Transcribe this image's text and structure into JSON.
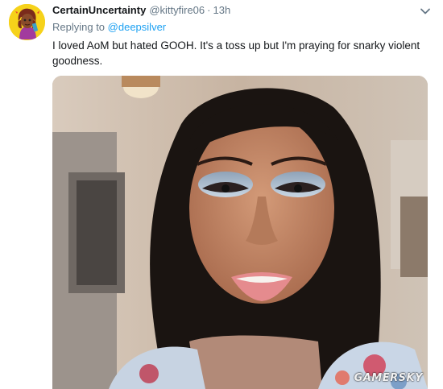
{
  "tweet": {
    "display_name": "CertainUncertainty",
    "handle": "@kittyfire06",
    "separator": "·",
    "time": "13h",
    "replying_prefix": "Replying to",
    "replying_to": "@deepsilver",
    "text": "I loved AoM but hated GOOH. It's a toss up but I'm praying for snarky violent goodness.",
    "avatar_icon": "cartoon-avatar-icon",
    "menu_icon": "chevron-down-icon",
    "media_type": "video-still"
  },
  "watermark": {
    "text": "GAMERSKY"
  },
  "colors": {
    "link": "#1da1f2",
    "secondary_text": "#657786",
    "primary_text": "#14171a",
    "avatar_bg": "#f6d21a"
  }
}
